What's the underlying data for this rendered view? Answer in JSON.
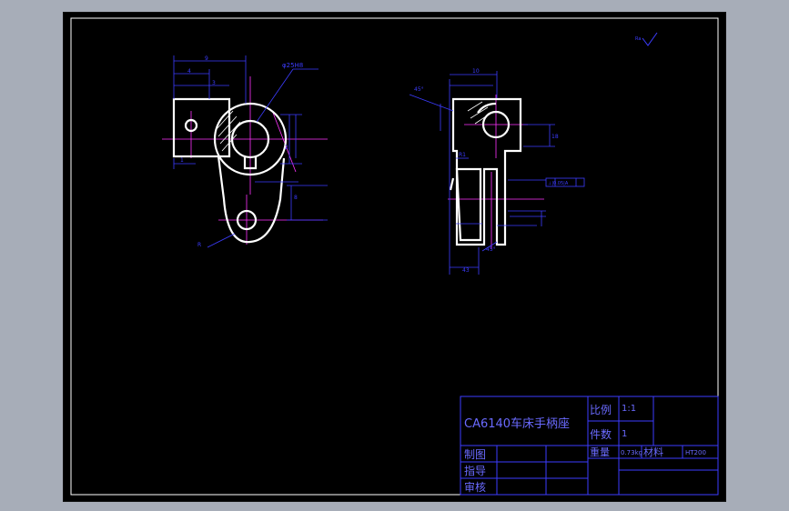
{
  "title_block": {
    "drawing_title": "CA6140车床手柄座",
    "scale_label": "比例",
    "scale_value": "1:1",
    "quantity_label": "件数",
    "quantity_value": "1",
    "weight_label": "重量",
    "weight_value": "0.73kg",
    "material_label": "材料",
    "material_value": "HT200",
    "drawn_label": "制图",
    "designer_label": "指导",
    "reviewer_label": "审核"
  },
  "dimensions": {
    "bore_diameter": "φ25H8",
    "roughness_top": "Ra",
    "roughness_mark": "⊥0.05",
    "tolerance_frame": "⊥|0.05|A"
  },
  "colors": {
    "background": "#000000",
    "part_outline": "#ffffff",
    "dimension_lines": "#3c3cff",
    "center_lines": "#ff33ff",
    "frame": "#ffffff",
    "title_block_lines": "#3c3cff",
    "title_block_text": "#6a6aff"
  }
}
